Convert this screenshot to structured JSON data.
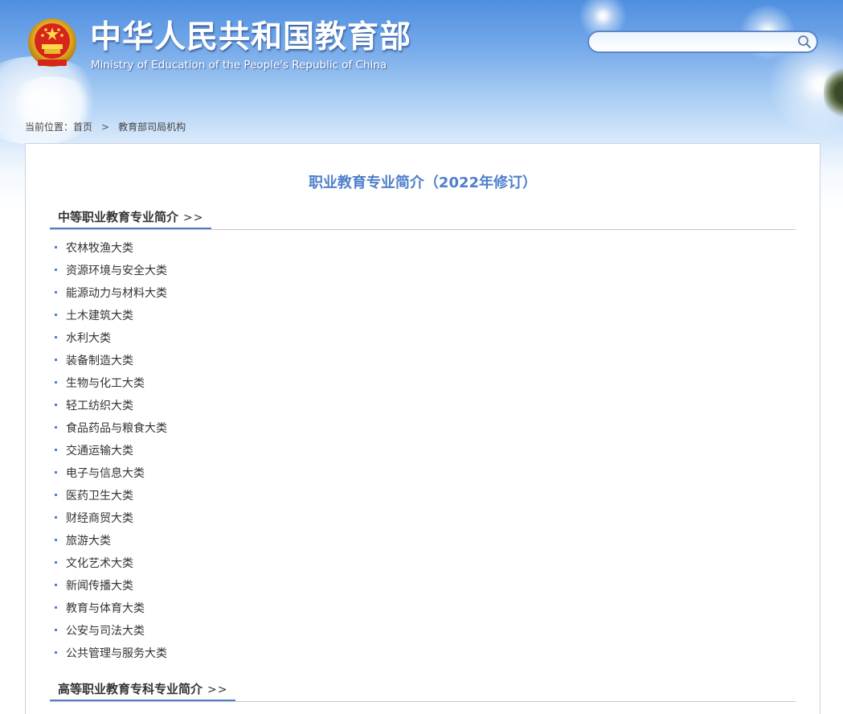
{
  "header": {
    "title": "中华人民共和国教育部",
    "subtitle": "Ministry of Education of the People's Republic of China",
    "emblem_icon": "national-emblem-icon",
    "search": {
      "value": "",
      "icon": "search-icon"
    }
  },
  "breadcrumb": {
    "prefix": "当前位置：",
    "items": [
      "首页",
      "教育部司局机构"
    ],
    "separator": ">"
  },
  "main": {
    "title": "职业教育专业简介（2022年修订）",
    "sections": [
      {
        "label": "中等职业教育专业简介",
        "arrows": ">>",
        "items": [
          "农林牧渔大类",
          "资源环境与安全大类",
          "能源动力与材料大类",
          "土木建筑大类",
          "水利大类",
          "装备制造大类",
          "生物与化工大类",
          "轻工纺织大类",
          "食品药品与粮食大类",
          "交通运输大类",
          "电子与信息大类",
          "医药卫生大类",
          "财经商贸大类",
          "旅游大类",
          "文化艺术大类",
          "新闻传播大类",
          "教育与体育大类",
          "公安与司法大类",
          "公共管理与服务大类"
        ]
      },
      {
        "label": "高等职业教育专科专业简介",
        "arrows": ">>",
        "items": []
      }
    ]
  },
  "colors": {
    "accent": "#4f7fcb",
    "header_blue": "#4f8fe0",
    "text": "#333333"
  }
}
